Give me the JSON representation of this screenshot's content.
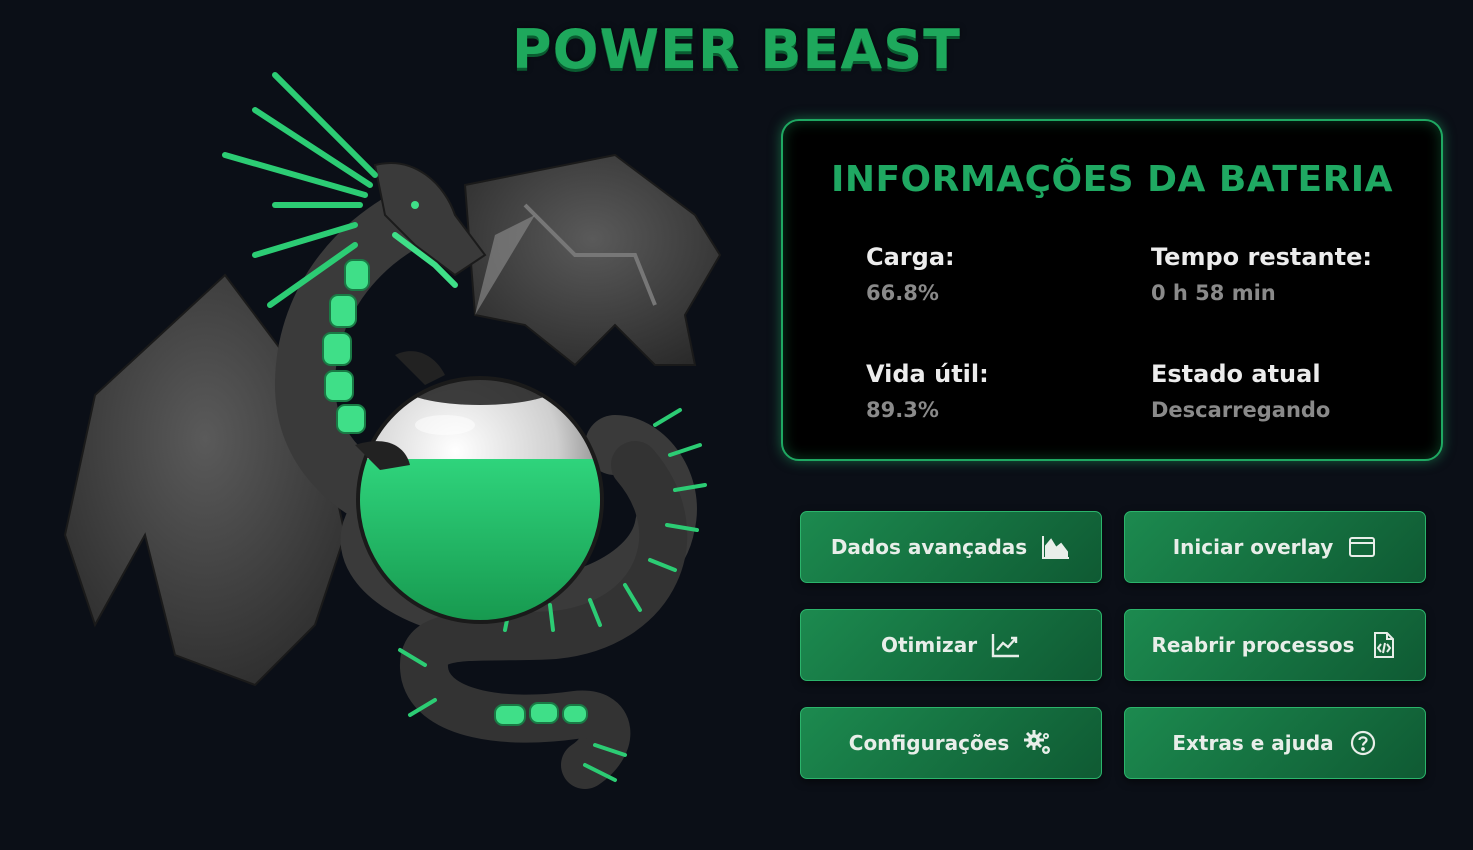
{
  "app": {
    "title": "POWER BEAST"
  },
  "battery": {
    "panel_title": "INFORMAÇÕES DA BATERIA",
    "charge_label": "Carga:",
    "charge_value": "66.8%",
    "time_label": "Tempo restante:",
    "time_value": "0 h 58 min",
    "health_label": "Vida útil:",
    "health_value": "89.3%",
    "state_label": "Estado atual",
    "state_value": "Descarregando",
    "orb_fill": 0.668
  },
  "buttons": [
    {
      "label": "Dados avançadas",
      "icon": "area-chart-icon"
    },
    {
      "label": "Iniciar overlay",
      "icon": "window-icon"
    },
    {
      "label": "Otimizar",
      "icon": "trend-up-icon"
    },
    {
      "label": "Reabrir processos",
      "icon": "code-file-icon"
    },
    {
      "label": "Configurações",
      "icon": "gears-icon"
    },
    {
      "label": "Extras e ajuda",
      "icon": "help-circle-icon"
    }
  ],
  "colors": {
    "background": "#0b0f17",
    "accent": "#1fa862",
    "button": "#157a44",
    "orb_liquid": "#22c36d"
  }
}
